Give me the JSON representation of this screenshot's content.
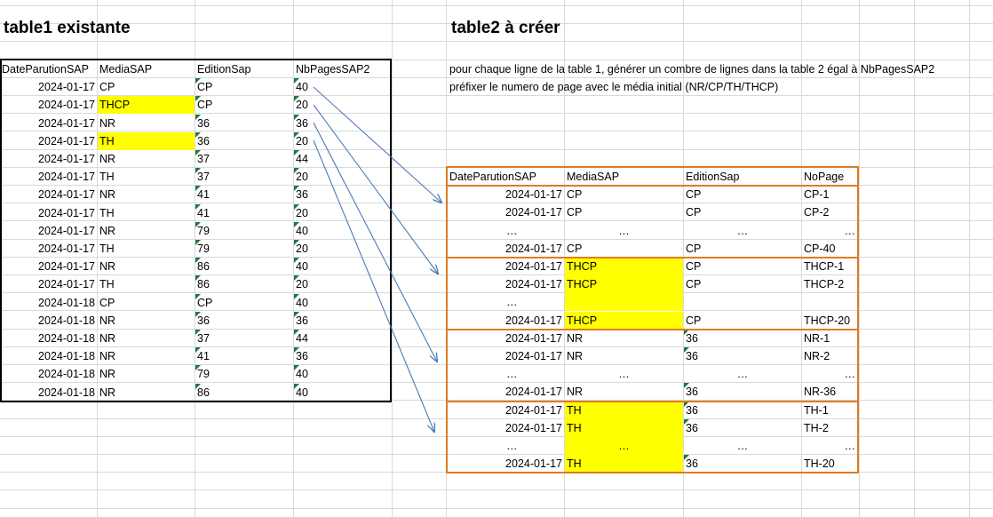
{
  "titles": {
    "table1": "table1 existante",
    "table2": "table2 à créer"
  },
  "notes": [
    "pour chaque ligne de la table 1, générer un combre de lignes dans la table 2 égal à NbPagesSAP2",
    "préfixer le numero de page avec le média initial (NR/CP/TH/THCP)"
  ],
  "table1": {
    "headers": [
      "DateParutionSAP",
      "MediaSAP",
      "EditionSap",
      "NbPagesSAP2"
    ],
    "rows": [
      {
        "date": "2024-01-17",
        "media": "CP",
        "edition": "CP",
        "pages": "40",
        "hl": false
      },
      {
        "date": "2024-01-17",
        "media": "THCP",
        "edition": "CP",
        "pages": "20",
        "hl": true
      },
      {
        "date": "2024-01-17",
        "media": "NR",
        "edition": "36",
        "pages": "36",
        "hl": false
      },
      {
        "date": "2024-01-17",
        "media": "TH",
        "edition": "36",
        "pages": "20",
        "hl": true
      },
      {
        "date": "2024-01-17",
        "media": "NR",
        "edition": "37",
        "pages": "44",
        "hl": false
      },
      {
        "date": "2024-01-17",
        "media": "TH",
        "edition": "37",
        "pages": "20",
        "hl": false
      },
      {
        "date": "2024-01-17",
        "media": "NR",
        "edition": "41",
        "pages": "36",
        "hl": false
      },
      {
        "date": "2024-01-17",
        "media": "TH",
        "edition": "41",
        "pages": "20",
        "hl": false
      },
      {
        "date": "2024-01-17",
        "media": "NR",
        "edition": "79",
        "pages": "40",
        "hl": false
      },
      {
        "date": "2024-01-17",
        "media": "TH",
        "edition": "79",
        "pages": "20",
        "hl": false
      },
      {
        "date": "2024-01-17",
        "media": "NR",
        "edition": "86",
        "pages": "40",
        "hl": false
      },
      {
        "date": "2024-01-17",
        "media": "TH",
        "edition": "86",
        "pages": "20",
        "hl": false
      },
      {
        "date": "2024-01-18",
        "media": "CP",
        "edition": "CP",
        "pages": "40",
        "hl": false
      },
      {
        "date": "2024-01-18",
        "media": "NR",
        "edition": "36",
        "pages": "36",
        "hl": false
      },
      {
        "date": "2024-01-18",
        "media": "NR",
        "edition": "37",
        "pages": "44",
        "hl": false
      },
      {
        "date": "2024-01-18",
        "media": "NR",
        "edition": "41",
        "pages": "36",
        "hl": false
      },
      {
        "date": "2024-01-18",
        "media": "NR",
        "edition": "79",
        "pages": "40",
        "hl": false
      },
      {
        "date": "2024-01-18",
        "media": "NR",
        "edition": "86",
        "pages": "40",
        "hl": false
      }
    ]
  },
  "table2": {
    "headers": [
      "DateParutionSAP",
      "MediaSAP",
      "EditionSap",
      "NoPage"
    ],
    "groups": [
      {
        "rows": [
          {
            "date": "2024-01-17",
            "media": "CP",
            "edition": "CP",
            "page": "CP-1"
          },
          {
            "date": "2024-01-17",
            "media": "CP",
            "edition": "CP",
            "page": "CP-2"
          },
          {
            "date": "…",
            "media": "…",
            "edition": "…",
            "page": "…",
            "ellipsis": true
          },
          {
            "date": "2024-01-17",
            "media": "CP",
            "edition": "CP",
            "page": "CP-40"
          }
        ]
      },
      {
        "rows": [
          {
            "date": "2024-01-17",
            "media": "THCP",
            "edition": "CP",
            "page": "THCP-1",
            "hl": true
          },
          {
            "date": "2024-01-17",
            "media": "THCP",
            "edition": "CP",
            "page": "THCP-2",
            "hl": true
          },
          {
            "date": "…",
            "media": "",
            "edition": "",
            "page": "",
            "ellipsis": true,
            "hl": true
          },
          {
            "date": "2024-01-17",
            "media": "THCP",
            "edition": "CP",
            "page": "THCP-20",
            "hl": true
          }
        ]
      },
      {
        "rows": [
          {
            "date": "2024-01-17",
            "media": "NR",
            "edition": "36",
            "page": "NR-1"
          },
          {
            "date": "2024-01-17",
            "media": "NR",
            "edition": "36",
            "page": "NR-2"
          },
          {
            "date": "…",
            "media": "…",
            "edition": "…",
            "page": "…",
            "ellipsis": true
          },
          {
            "date": "2024-01-17",
            "media": "NR",
            "edition": "36",
            "page": "NR-36"
          }
        ]
      },
      {
        "rows": [
          {
            "date": "2024-01-17",
            "media": "TH",
            "edition": "36",
            "page": "TH-1",
            "hl": true
          },
          {
            "date": "2024-01-17",
            "media": "TH",
            "edition": "36",
            "page": "TH-2",
            "hl": true
          },
          {
            "date": "…",
            "media": "…",
            "edition": "…",
            "page": "…",
            "ellipsis": true,
            "hl": true
          },
          {
            "date": "2024-01-17",
            "media": "TH",
            "edition": "36",
            "page": "TH-20",
            "hl": true
          }
        ]
      }
    ]
  },
  "colors": {
    "highlight": "#ffff00",
    "table1_border": "#000000",
    "table2_border": "#e07b1f",
    "arrow": "#4a7ab5",
    "gridline": "#d9d9d9",
    "text_marker": "#1f7a3a"
  }
}
